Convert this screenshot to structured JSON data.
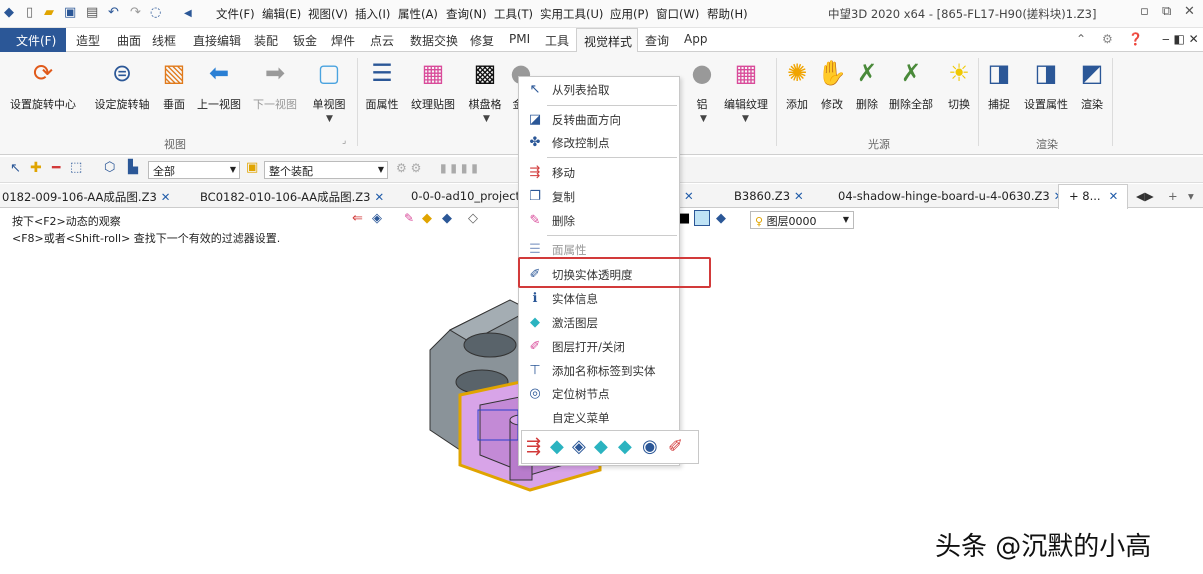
{
  "app": {
    "title": "中望3D 2020 x64 - [865-FL17-H90(搓料块)1.Z3]",
    "menus": [
      "文件(F)",
      "编辑(E)",
      "视图(V)",
      "插入(I)",
      "属性(A)",
      "查询(N)",
      "工具(T)",
      "实用工具(U)",
      "应用(P)",
      "窗口(W)",
      "帮助(H)"
    ]
  },
  "ribbon": {
    "file_tab": "文件(F)",
    "tabs": [
      "造型",
      "曲面",
      "线框",
      "直接编辑",
      "装配",
      "钣金",
      "焊件",
      "点云",
      "数据交换",
      "修复",
      "PMI",
      "工具"
    ],
    "active_tab": "视觉样式",
    "tabs_after": [
      "查询",
      "App"
    ],
    "buttons": [
      {
        "label": "设置旋转中心",
        "icon": "rotate-center-icon",
        "color": "#e05a1b"
      },
      {
        "label": "设定旋转轴",
        "icon": "rotate-axis-icon",
        "color": "#2b5797"
      },
      {
        "label": "垂面",
        "icon": "normal-view-icon",
        "color": "#e07a1b"
      },
      {
        "label": "上一视图",
        "icon": "prev-view-icon",
        "color": "#2a7fd4"
      },
      {
        "label": "下一视图",
        "icon": "next-view-icon",
        "color": "#9a9a9a"
      },
      {
        "label": "单视图",
        "icon": "single-view-icon",
        "color": "#4aa3df"
      },
      {
        "label": "面属性",
        "icon": "face-attr-icon",
        "color": "#2b5797"
      },
      {
        "label": "纹理贴图",
        "icon": "texture-icon",
        "color": "#d94b9a"
      },
      {
        "label": "棋盘格",
        "icon": "checker-icon",
        "color": "#111111"
      },
      {
        "label": "金",
        "icon": "material-gold-icon",
        "color": "#999999"
      },
      {
        "label": "铝",
        "icon": "material-aluminum-icon",
        "color": "#999999"
      },
      {
        "label": "编辑纹理",
        "icon": "edit-texture-icon",
        "color": "#d94b9a"
      },
      {
        "label": "添加",
        "icon": "light-add-icon",
        "color": "#f0a400"
      },
      {
        "label": "修改",
        "icon": "light-modify-icon",
        "color": "#f0a400"
      },
      {
        "label": "删除",
        "icon": "light-delete-icon",
        "color": "#4a8a3a"
      },
      {
        "label": "删除全部",
        "icon": "light-delete-all-icon",
        "color": "#4a8a3a"
      },
      {
        "label": "切换",
        "icon": "light-switch-icon",
        "color": "#f0c800"
      },
      {
        "label": "捕捉",
        "icon": "capture-icon",
        "color": "#2b5797"
      },
      {
        "label": "设置属性",
        "icon": "render-settings-icon",
        "color": "#2b5797"
      },
      {
        "label": "渲染",
        "icon": "render-icon",
        "color": "#2b5797"
      }
    ],
    "groups": [
      "视图",
      "光源",
      "渲染"
    ]
  },
  "toolbar2": {
    "filter_value": "全部",
    "scope_value": "整个装配"
  },
  "doc_tabs": [
    "0182-009-106-AA成品图.Z3",
    "BC0182-010-106-AA成品图.Z3",
    "0-0-0-ad10_project_as",
    "B3860.Z3",
    "04-shadow-hinge-board-u-4-0630.Z3"
  ],
  "active_doc_tab": "+ 8...",
  "viewport": {
    "hint1": "按下<F2>动态的观察",
    "hint2": "<F8>或者<Shift-roll> 查找下一个有效的过滤器设置.",
    "layer_value": "图层0000"
  },
  "context_menu": {
    "items": [
      {
        "label": "从列表拾取",
        "icon": "cursor-icon",
        "disabled": false
      },
      {
        "label": "反转曲面方向",
        "icon": "flip-face-icon",
        "disabled": false
      },
      {
        "label": "修改控制点",
        "icon": "control-point-icon",
        "disabled": false
      },
      {
        "label": "移动",
        "icon": "move-icon",
        "disabled": false
      },
      {
        "label": "复制",
        "icon": "copy-icon",
        "disabled": false
      },
      {
        "label": "删除",
        "icon": "delete-icon",
        "disabled": false
      },
      {
        "label": "面属性",
        "icon": "face-attr-icon",
        "disabled": true
      },
      {
        "label": "切换实体透明度",
        "icon": "transparency-icon",
        "disabled": false
      },
      {
        "label": "实体信息",
        "icon": "info-icon",
        "disabled": false
      },
      {
        "label": "激活图层",
        "icon": "layer-activate-icon",
        "disabled": false
      },
      {
        "label": "图层打开/关闭",
        "icon": "layer-toggle-icon",
        "disabled": false
      },
      {
        "label": "添加名称标签到实体",
        "icon": "name-tag-icon",
        "disabled": false
      },
      {
        "label": "定位树节点",
        "icon": "locate-node-icon",
        "disabled": false
      },
      {
        "label": "自定义菜单",
        "icon": "custom-menu-icon",
        "disabled": false
      }
    ],
    "highlighted_index": 7
  },
  "watermark": "头条 @沉默的小高"
}
